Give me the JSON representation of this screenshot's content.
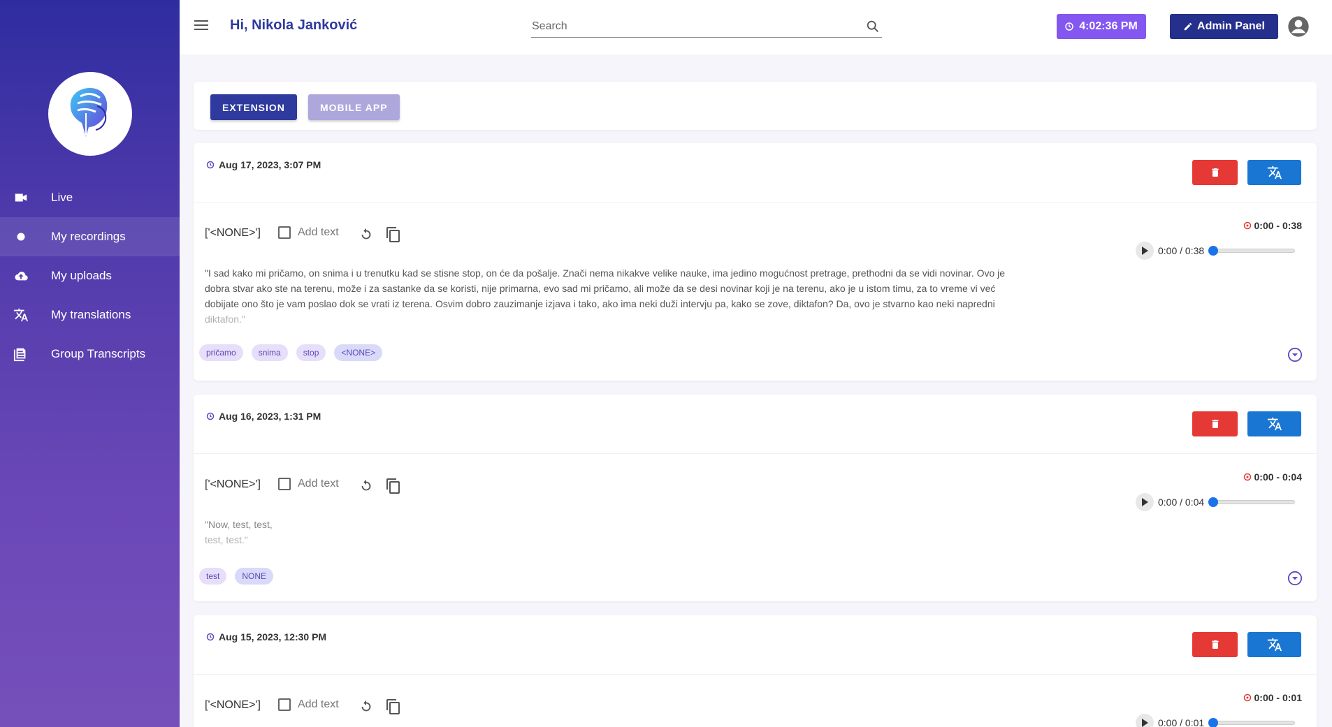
{
  "sidebar": {
    "items": [
      {
        "label": "Live",
        "icon": "video-camera-icon"
      },
      {
        "label": "My recordings",
        "icon": "record-dot-icon"
      },
      {
        "label": "My uploads",
        "icon": "cloud-upload-icon"
      },
      {
        "label": "My translations",
        "icon": "translate-icon"
      },
      {
        "label": "Group Transcripts",
        "icon": "document-icon"
      }
    ],
    "active_index": 1
  },
  "header": {
    "greeting": "Hi, Nikola Janković",
    "search_placeholder": "Search",
    "clock": "4:02:36 PM",
    "admin_label": "Admin Panel"
  },
  "tabs": {
    "extension": "EXTENSION",
    "mobile_app": "MOBILE APP"
  },
  "recordings": [
    {
      "date": "Aug 17, 2023, 3:07 PM",
      "speaker": "['<NONE>']",
      "add_text": "Add text",
      "time_range": "0:00 - 0:38",
      "player_time": "0:00 / 0:38",
      "progress": 0,
      "transcript_lines": [
        "\"I sad kako mi pričamo, on snima i u trenutku kad se stisne stop, on će da pošalje. Znači nema nikakve velike nauke, ima jedino mogućnost pretrage, prethodni da se vidi novinar. Ovo je",
        "dobra stvar ako ste na terenu, može i za sastanke da se koristi, nije primarna, evo sad mi pričamo, ali može da se desi novinar koji je na terenu, ako je u istom timu, za to vreme vi već",
        "dobijate ono što je vam poslao dok se vrati iz terena. Osvim dobro zauzimanje izjava i tako, ako ima neki duži intervju pa, kako se zove, diktafon? Da, ovo je stvarno kao neki napredni",
        "diktafon.\""
      ],
      "tags": [
        "pričamo",
        "snima",
        "stop",
        "<NONE>"
      ]
    },
    {
      "date": "Aug 16, 2023, 1:31 PM",
      "speaker": "['<NONE>']",
      "add_text": "Add text",
      "time_range": "0:00 - 0:04",
      "player_time": "0:00 / 0:04",
      "progress": 0,
      "transcript_lines": [
        "\"Now, test, test,",
        "test, test.\""
      ],
      "tags": [
        "test",
        "NONE"
      ]
    },
    {
      "date": "Aug 15, 2023, 12:30 PM",
      "speaker": "['<NONE>']",
      "add_text": "Add text",
      "time_range": "0:00 - 0:01",
      "player_time": "0:00 / 0:01",
      "progress": 0
    }
  ],
  "colors": {
    "sidebar_top": "#2e2da0",
    "sidebar_bottom": "#7550bb",
    "accent_purple": "#8357f0",
    "admin_blue": "#252f8c",
    "delete_red": "#e53935",
    "translate_blue": "#1976d2",
    "tag_bg": "#e7defa"
  }
}
